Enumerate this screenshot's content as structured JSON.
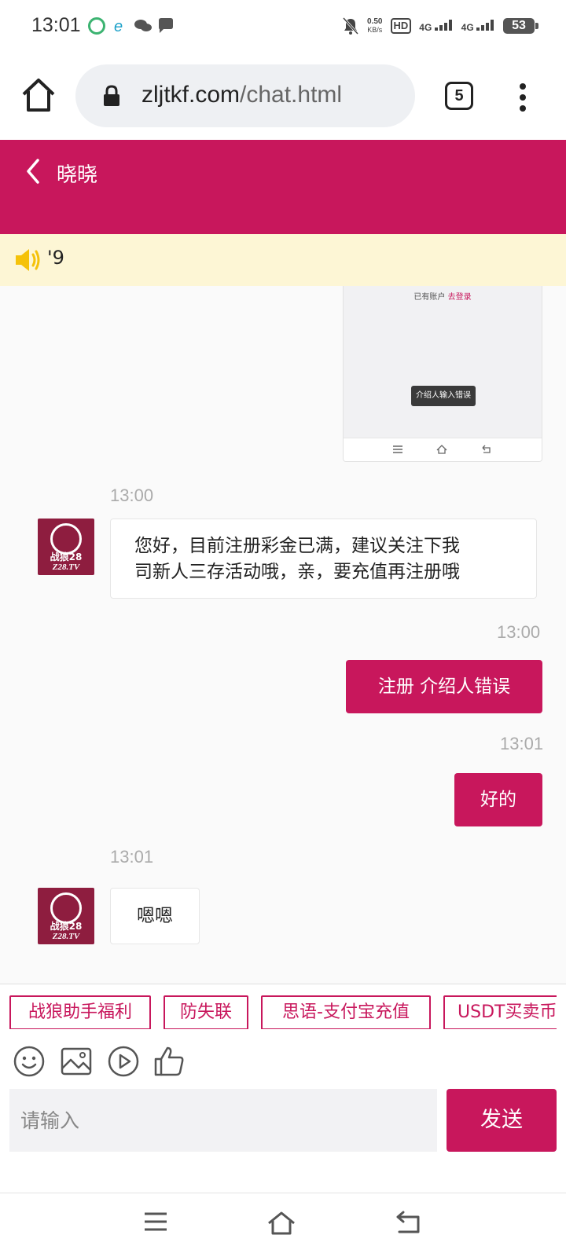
{
  "status_bar": {
    "time": "13:01",
    "net_speed_value": "0.50",
    "net_speed_unit": "KB/s",
    "hd_label": "HD",
    "signal_1": "4G",
    "signal_2": "4G",
    "battery": "53"
  },
  "browser": {
    "url_domain": "zljtkf.com",
    "url_path": "/chat.html",
    "tab_count": "5"
  },
  "chat": {
    "title": "晓晓",
    "notice": "'9"
  },
  "image_message": {
    "login_text": "已有账户",
    "login_link": "去登录",
    "toast": "介绍人输入错误"
  },
  "messages": [
    {
      "direction": "incoming",
      "time": "13:00",
      "text_line1": "您好，目前注册彩金已满，建议关注下我",
      "text_line2": "司新人三存活动哦，亲，要充值再注册哦"
    },
    {
      "direction": "outgoing",
      "time": "13:00",
      "text": "注册 介绍人错误"
    },
    {
      "direction": "outgoing",
      "time": "13:01",
      "text": "好的"
    },
    {
      "direction": "incoming",
      "time": "13:01",
      "text": "嗯嗯"
    }
  ],
  "avatar": {
    "line1": "战狼28",
    "line2": "Z28.TV"
  },
  "quick_replies": [
    "战狼助手福利",
    "防失联",
    "思语-支付宝充值",
    "USDT买卖币"
  ],
  "input": {
    "placeholder": "请输入",
    "send_label": "发送"
  },
  "colors": {
    "accent": "#c8175c",
    "notice_bg": "#fdf6d5",
    "speaker": "#f5c20a"
  }
}
